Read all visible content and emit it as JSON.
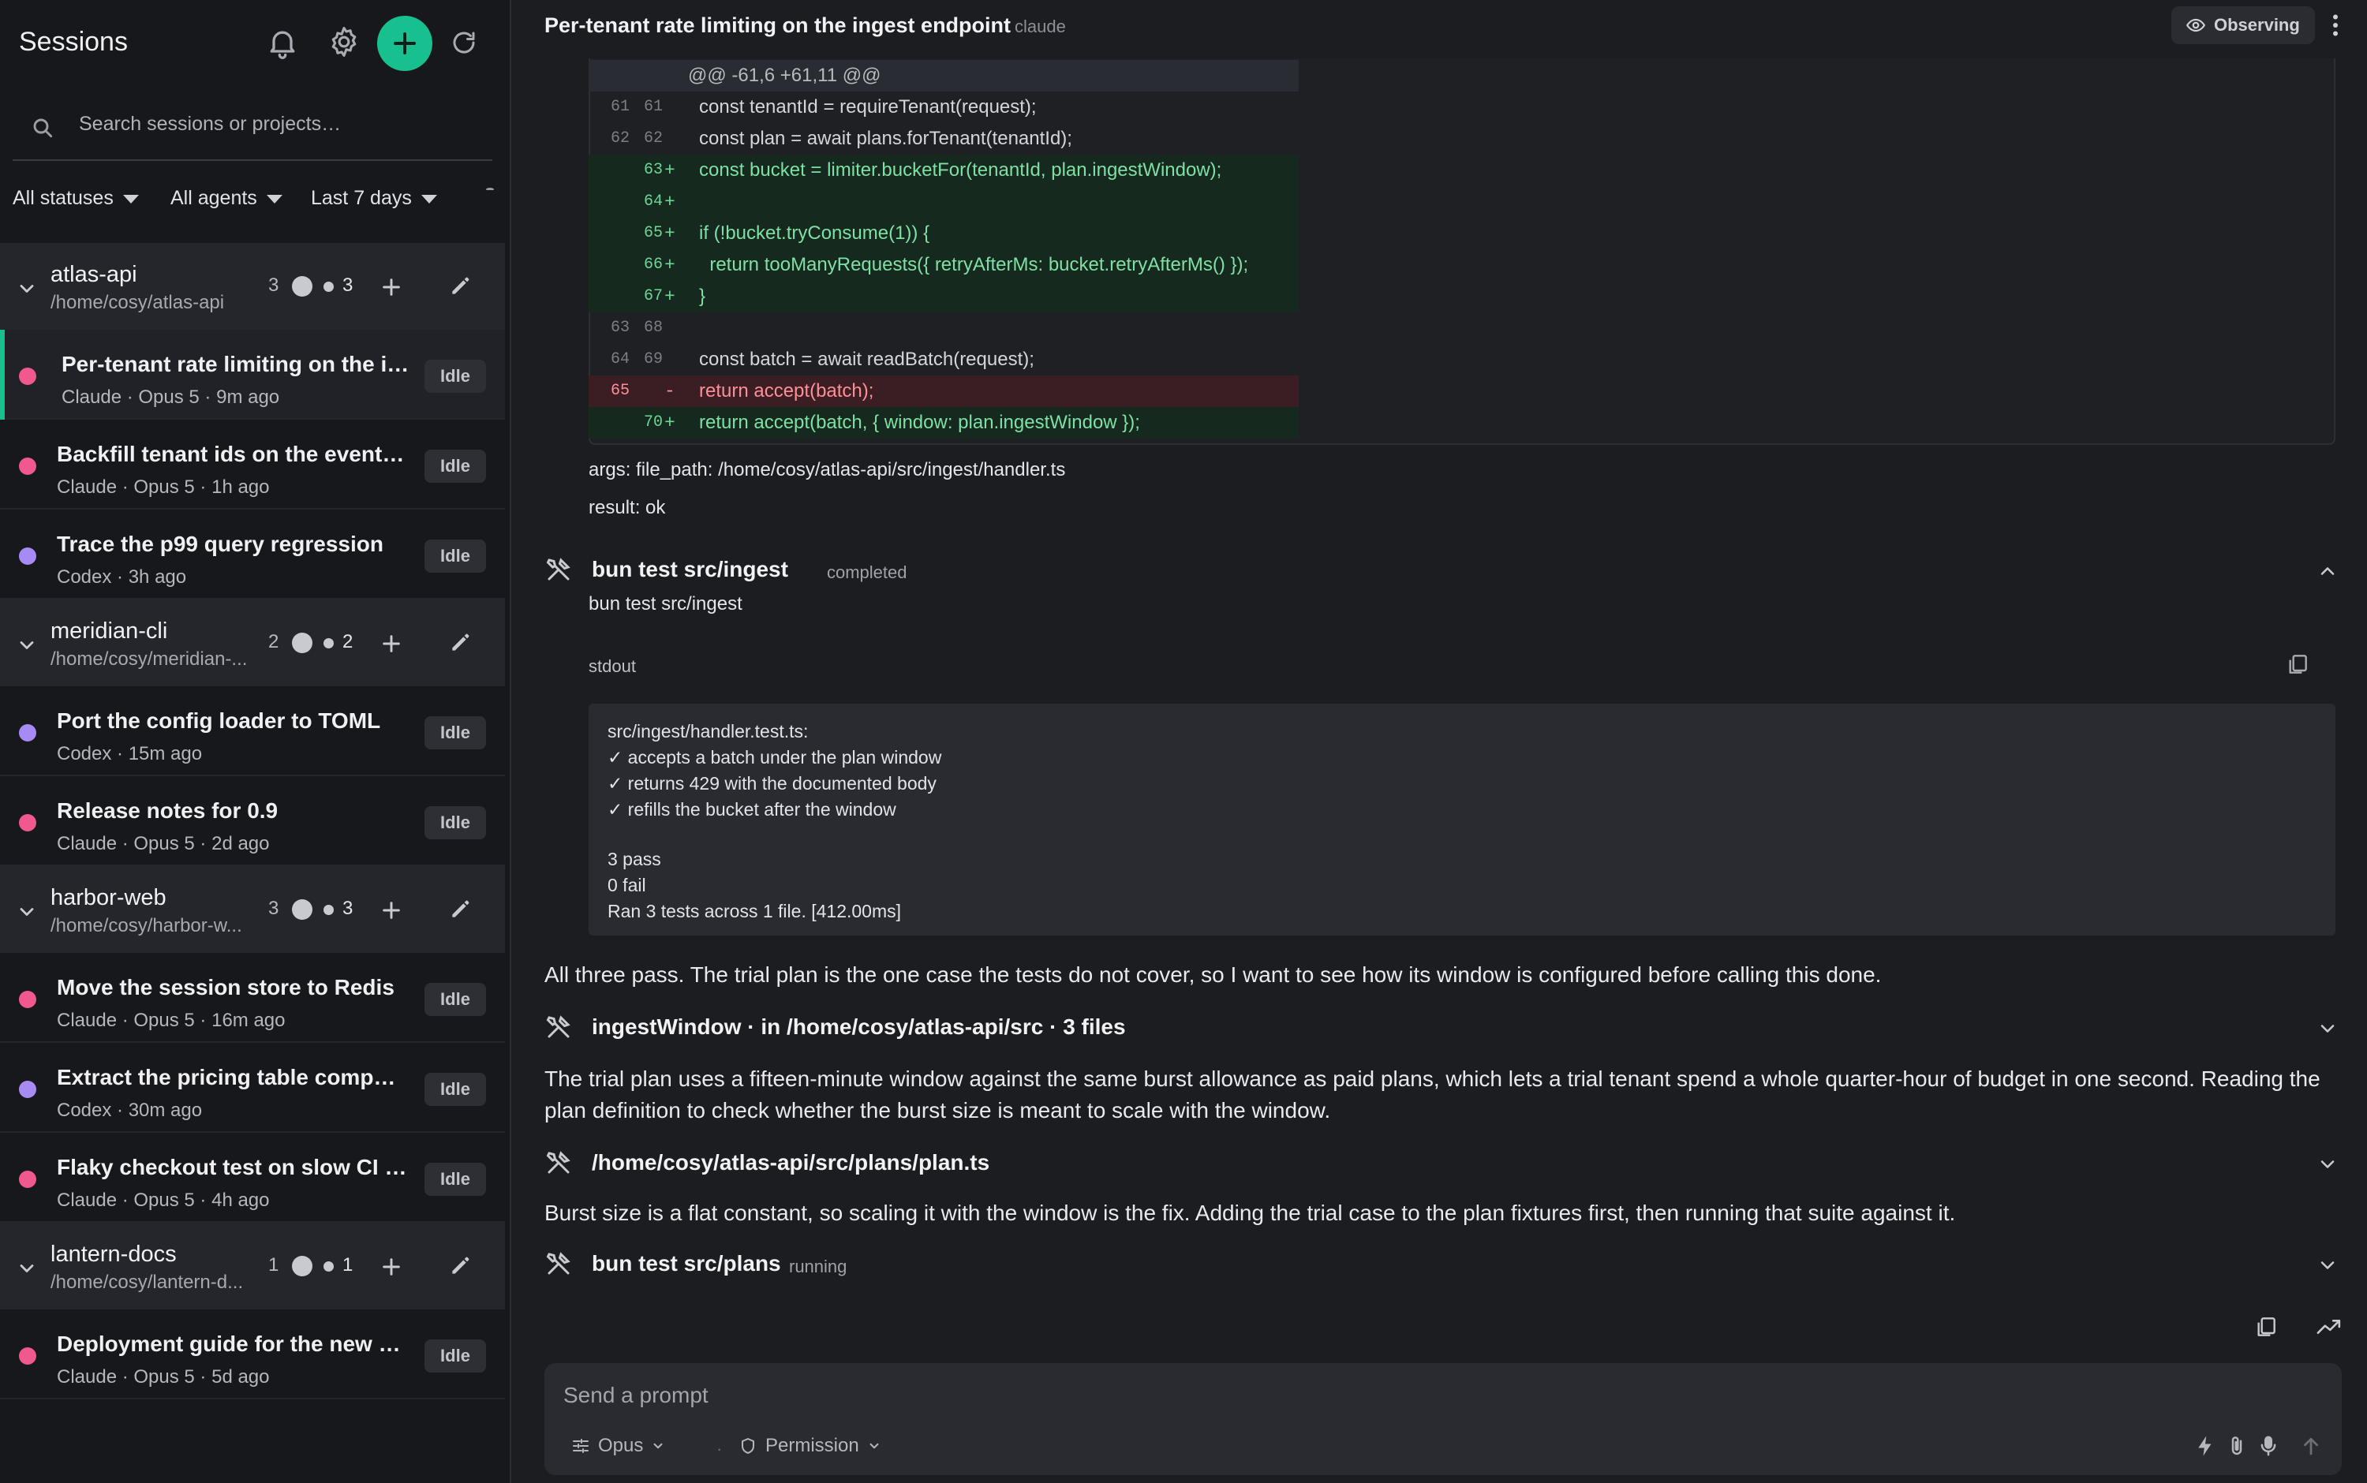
{
  "sidebar": {
    "title": "Sessions",
    "search": {
      "placeholder": "Search sessions or projects…",
      "value": ""
    },
    "filters": {
      "status": "All statuses",
      "agent": "All agents",
      "range": "Last 7 days"
    },
    "groups": [
      {
        "name": "atlas-api",
        "path": "/home/cosy/atlas-api",
        "count": "3",
        "count2": "3",
        "sessions": [
          {
            "title": "Per-tenant rate limiting on the in...",
            "meta": "Claude · Opus 5 · 9m ago",
            "badge": "Idle",
            "dot": "#f0588e",
            "active": true
          },
          {
            "title": "Backfill tenant ids on the events ...",
            "meta": "Claude · Opus 5 · 1h ago",
            "badge": "Idle",
            "dot": "#f0588e"
          },
          {
            "title": "Trace the p99 query regression",
            "meta": "Codex · 3h ago",
            "badge": "Idle",
            "dot": "#a68bf5"
          }
        ]
      },
      {
        "name": "meridian-cli",
        "path": "/home/cosy/meridian-...",
        "count": "2",
        "count2": "2",
        "sessions": [
          {
            "title": "Port the config loader to TOML",
            "meta": "Codex · 15m ago",
            "badge": "Idle",
            "dot": "#a68bf5"
          },
          {
            "title": "Release notes for 0.9",
            "meta": "Claude · Opus 5 · 2d ago",
            "badge": "Idle",
            "dot": "#f0588e"
          }
        ]
      },
      {
        "name": "harbor-web",
        "path": "/home/cosy/harbor-w...",
        "count": "3",
        "count2": "3",
        "sessions": [
          {
            "title": "Move the session store to Redis",
            "meta": "Claude · Opus 5 · 16m ago",
            "badge": "Idle",
            "dot": "#f0588e"
          },
          {
            "title": "Extract the pricing table compon...",
            "meta": "Codex · 30m ago",
            "badge": "Idle",
            "dot": "#a68bf5"
          },
          {
            "title": "Flaky checkout test on slow CI r...",
            "meta": "Claude · Opus 5 · 4h ago",
            "badge": "Idle",
            "dot": "#f0588e"
          }
        ]
      },
      {
        "name": "lantern-docs",
        "path": "/home/cosy/lantern-d...",
        "count": "1",
        "count2": "1",
        "sessions": [
          {
            "title": "Deployment guide for the new ru...",
            "meta": "Claude · Opus 5 · 5d ago",
            "badge": "Idle",
            "dot": "#f0588e"
          }
        ]
      }
    ]
  },
  "header": {
    "title": "Per-tenant rate limiting on the ingest endpoint",
    "agent": "claude",
    "observing_label": "Observing"
  },
  "diff": {
    "hunk": "@@ -61,6 +61,11 @@",
    "lines": [
      {
        "type": "ctx",
        "old": "61",
        "new": "61",
        "mark": "",
        "code": "const tenantId = requireTenant(request);"
      },
      {
        "type": "ctx",
        "old": "62",
        "new": "62",
        "mark": "",
        "code": "const plan = await plans.forTenant(tenantId);"
      },
      {
        "type": "add",
        "old": "",
        "new": "63",
        "mark": "+",
        "code": "const bucket = limiter.bucketFor(tenantId, plan.ingestWindow);"
      },
      {
        "type": "add",
        "old": "",
        "new": "64",
        "mark": "+",
        "code": ""
      },
      {
        "type": "add",
        "old": "",
        "new": "65",
        "mark": "+",
        "code": "if (!bucket.tryConsume(1)) {"
      },
      {
        "type": "add",
        "old": "",
        "new": "66",
        "mark": "+",
        "code": "  return tooManyRequests({ retryAfterMs: bucket.retryAfterMs() });"
      },
      {
        "type": "add",
        "old": "",
        "new": "67",
        "mark": "+",
        "code": "}"
      },
      {
        "type": "ctx",
        "old": "63",
        "new": "68",
        "mark": "",
        "code": ""
      },
      {
        "type": "ctx",
        "old": "64",
        "new": "69",
        "mark": "",
        "code": "const batch = await readBatch(request);"
      },
      {
        "type": "del",
        "old": "65",
        "new": "",
        "mark": "-",
        "code": "return accept(batch);"
      },
      {
        "type": "add",
        "old": "",
        "new": "70",
        "mark": "+",
        "code": "return accept(batch, { window: plan.ingestWindow });"
      }
    ]
  },
  "tool_edit": {
    "args": "args: file_path: /home/cosy/atlas-api/src/ingest/handler.ts",
    "result": "result: ok"
  },
  "tool_test": {
    "title": "bun test src/ingest",
    "status": "completed",
    "command": "bun test src/ingest",
    "stdout_label": "stdout",
    "stdout": [
      "src/ingest/handler.test.ts:",
      "✓ accepts a batch under the plan window",
      "✓ returns 429 with the documented body",
      "✓ refills the bucket after the window",
      "",
      "3 pass",
      "0 fail",
      "Ran 3 tests across 1 file. [412.00ms]"
    ]
  },
  "messages": {
    "m1": "All three pass. The trial plan is the one case the tests do not cover, so I want to see how its window is configured before calling this done.",
    "tool_search": "ingestWindow · in /home/cosy/atlas-api/src · 3 files",
    "m2": "The trial plan uses a fifteen-minute window against the same burst allowance as paid plans, which lets a trial tenant spend a whole quarter-hour of budget in one second. Reading the plan definition to check whether the burst size is meant to scale with the window.",
    "tool_read": "/home/cosy/atlas-api/src/plans/plan.ts",
    "m3": "Burst size is a flat constant, so scaling it with the window is the fix. Adding the trial case to the plan fixtures first, then running that suite against it.",
    "tool_run": "bun test src/plans",
    "tool_run_status": "running"
  },
  "composer": {
    "placeholder": "Send a prompt",
    "model": "Opus",
    "separator": "·",
    "permission": "Permission"
  },
  "colors": {
    "accent": "#17c08e",
    "claude_dot": "#f0588e",
    "codex_dot": "#a68bf5"
  }
}
